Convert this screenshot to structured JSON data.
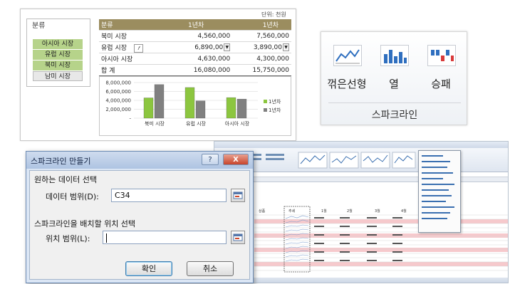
{
  "table_panel": {
    "filter_title": "분류",
    "filter_items": [
      "아시아 시장",
      "유럽 시장",
      "북미 시장",
      "남미 시장"
    ],
    "unit_label": "단위: 천원",
    "columns": [
      "분류",
      "1년차",
      "1년차"
    ],
    "rows": [
      {
        "name": "북미 시장",
        "y1": "4,560,000",
        "y2": "7,560,000"
      },
      {
        "name": "유럽 시장",
        "y1": "6,890,00",
        "y2": "3,890,00"
      },
      {
        "name": "아시아 시장",
        "y1": "4,630,000",
        "y2": "4,300,000"
      }
    ],
    "total_row": {
      "name": "합 계",
      "y1": "16,080,000",
      "y2": "15,750,000"
    }
  },
  "chart_data": {
    "type": "bar",
    "categories": [
      "북미 시장",
      "유럽 시장",
      "아시아 시장"
    ],
    "series": [
      {
        "name": "1년차",
        "values": [
          4560000,
          6890000,
          4630000
        ],
        "color": "#8cc63f"
      },
      {
        "name": "1년차",
        "values": [
          7560000,
          3890000,
          4300000
        ],
        "color": "#808080"
      }
    ],
    "yticks": [
      "8,000,000",
      "6,000,000",
      "4,000,000",
      "2,000,000",
      "-"
    ],
    "ylim": [
      0,
      8000000
    ],
    "legend": "right"
  },
  "ribbon": {
    "buttons": [
      {
        "label": "꺾은선형",
        "icon": "sparkline-line-icon"
      },
      {
        "label": "열",
        "icon": "sparkline-column-icon"
      },
      {
        "label": "승패",
        "icon": "sparkline-winloss-icon"
      }
    ],
    "group_label": "스파크라인"
  },
  "dialog": {
    "title": "스파크라인 만들기",
    "help_label": "?",
    "close_label": "X",
    "section1": "원하는 데이터 선택",
    "data_range_label": "데이터 범위(D):",
    "data_range_value": "C34",
    "section2": "스파크라인을 배치할 위치 선택",
    "location_label": "위치 범위(L):",
    "location_value": "",
    "ok_label": "확인",
    "cancel_label": "취소"
  },
  "excel": {
    "headers": [
      "상품",
      "추세",
      "1월",
      "2월",
      "3월",
      "4월"
    ]
  }
}
